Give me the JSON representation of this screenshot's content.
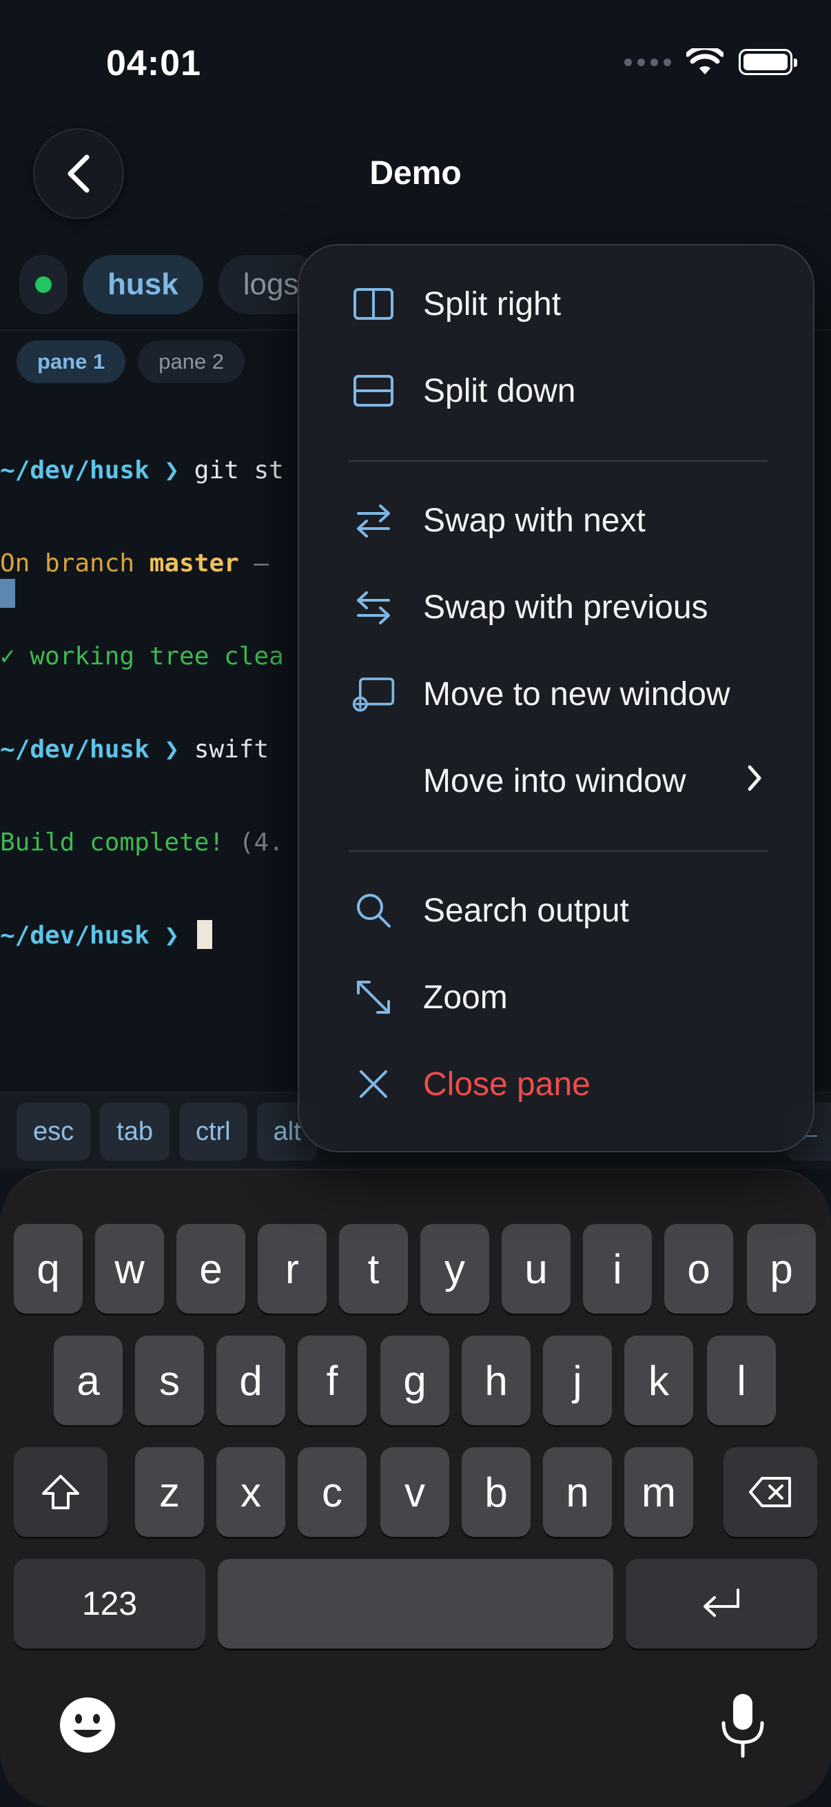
{
  "status_bar": {
    "time": "04:01"
  },
  "nav": {
    "title": "Demo"
  },
  "tabs": [
    {
      "label": "husk",
      "active": true
    },
    {
      "label": "logs",
      "active": false
    }
  ],
  "panes": [
    {
      "label": "pane 1",
      "active": true
    },
    {
      "label": "pane 2",
      "active": false
    }
  ],
  "terminal": {
    "line1": {
      "prompt": "~/dev/husk ❯ ",
      "cmd": "git st"
    },
    "line2": {
      "pre": "On branch ",
      "branch": "master",
      "post": " —"
    },
    "line3": {
      "text": "✓ working tree clea"
    },
    "line4": {
      "prompt": "~/dev/husk ❯ ",
      "cmd": "swift"
    },
    "line5": {
      "text": "Build complete! ",
      "extra": "(4."
    },
    "line6": {
      "prompt": "~/dev/husk ❯ "
    }
  },
  "accessory_keys": [
    "esc",
    "tab",
    "ctrl",
    "alt"
  ],
  "accessory_arrow": "←",
  "menu": {
    "items": [
      {
        "label": "Split right",
        "icon": "split-right-icon"
      },
      {
        "label": "Split down",
        "icon": "split-down-icon"
      },
      {
        "label": "Swap with next",
        "icon": "swap-icon"
      },
      {
        "label": "Swap with previous",
        "icon": "swap-icon"
      },
      {
        "label": "Move to new window",
        "icon": "new-window-icon"
      },
      {
        "label": "Move into window",
        "icon": "chevron-right-icon"
      },
      {
        "label": "Search output",
        "icon": "search-icon"
      },
      {
        "label": "Zoom",
        "icon": "zoom-icon"
      },
      {
        "label": "Close pane",
        "icon": "close-icon"
      }
    ],
    "danger_color": "#ef4b4b",
    "accent_color": "#7fb8e6"
  },
  "keyboard": {
    "row1": [
      "q",
      "w",
      "e",
      "r",
      "t",
      "y",
      "u",
      "i",
      "o",
      "p"
    ],
    "row2": [
      "a",
      "s",
      "d",
      "f",
      "g",
      "h",
      "j",
      "k",
      "l"
    ],
    "row3": [
      "z",
      "x",
      "c",
      "v",
      "b",
      "n",
      "m"
    ],
    "numbers_label": "123"
  }
}
